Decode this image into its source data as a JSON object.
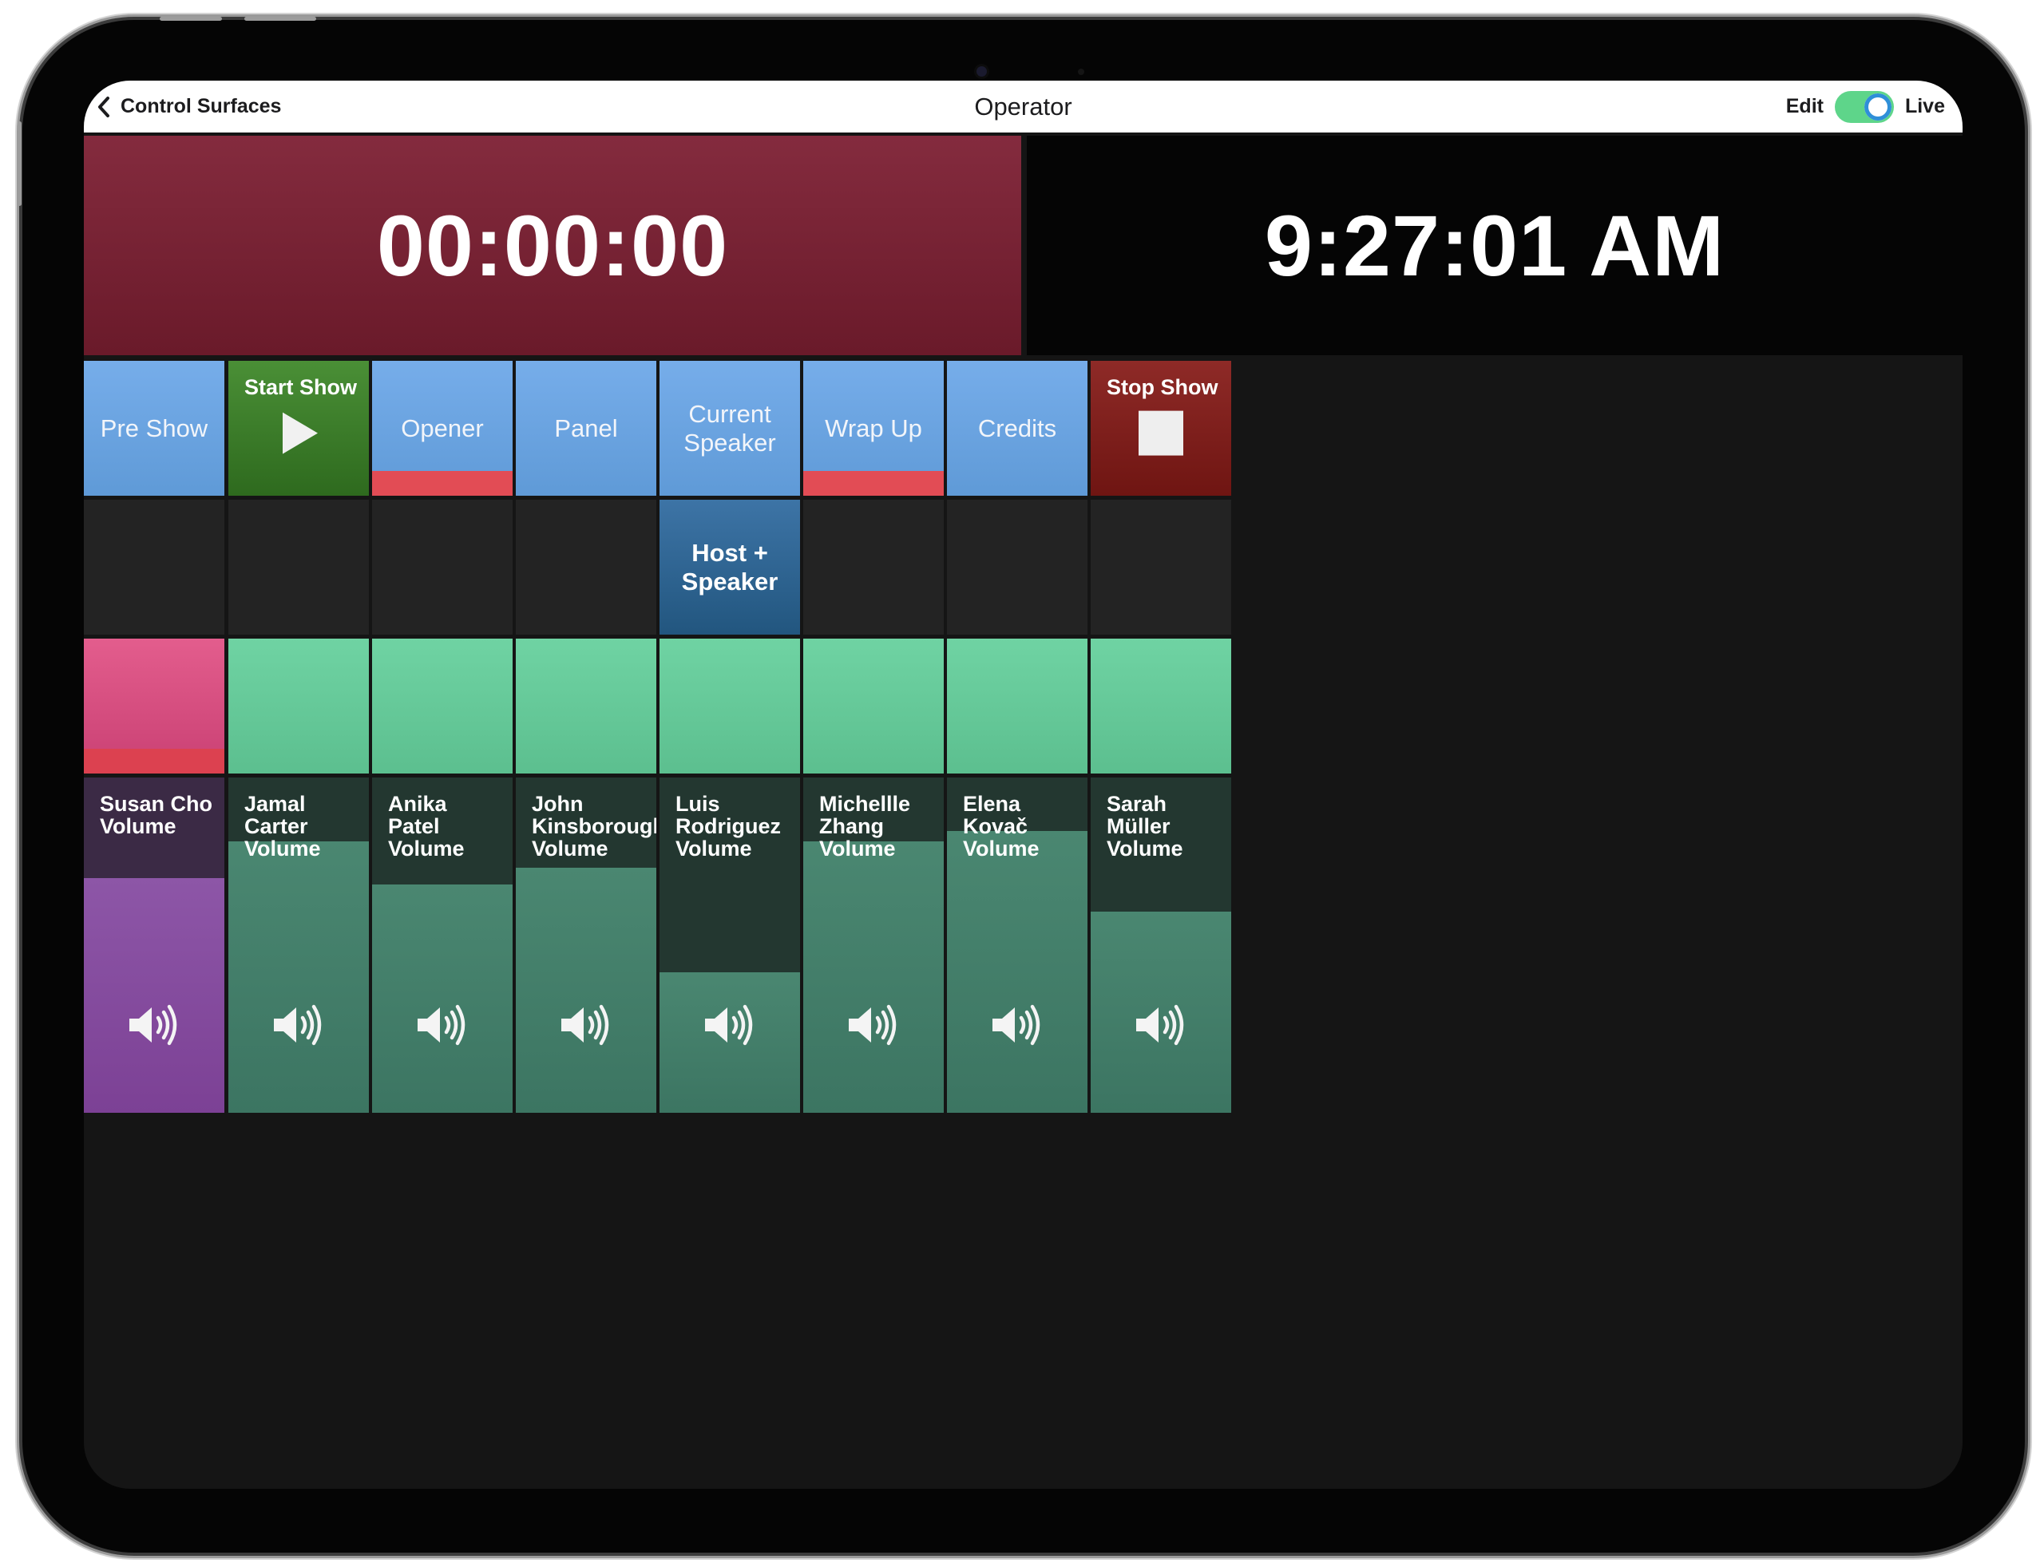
{
  "topbar": {
    "back_label": "Control Surfaces",
    "title": "Operator",
    "mode_left": "Edit",
    "mode_right": "Live",
    "live_enabled": true
  },
  "timers": {
    "countdown": "00:00:00",
    "clock": "9:27:01 AM"
  },
  "colors": {
    "cue_blue": "#6ea6e4",
    "start_green": "#3f8230",
    "stop_red": "#84201d",
    "active_red_bar": "#e24c55",
    "mint": "#66c99a",
    "pink": "#d74f80",
    "purple_fill": "#8550a0",
    "green_fill": "#447f6a",
    "toggle_green": "#5ed58a"
  },
  "row1": [
    {
      "label": "Pre Show",
      "style": "blue",
      "active": false
    },
    {
      "label": "Start Show",
      "style": "green",
      "icon": "play-icon"
    },
    {
      "label": "Opener",
      "style": "blue",
      "active": true
    },
    {
      "label": "Panel",
      "style": "blue",
      "active": false
    },
    {
      "label": "Current Speaker",
      "style": "blue",
      "active": false
    },
    {
      "label": "Wrap Up",
      "style": "blue",
      "active": true
    },
    {
      "label": "Credits",
      "style": "blue",
      "active": false
    },
    {
      "label": "Stop Show",
      "style": "red",
      "icon": "stop-icon"
    }
  ],
  "row2": [
    {
      "label": "",
      "style": "empty"
    },
    {
      "label": "",
      "style": "empty"
    },
    {
      "label": "",
      "style": "empty"
    },
    {
      "label": "",
      "style": "empty"
    },
    {
      "label": "Host + Speaker",
      "style": "navy"
    },
    {
      "label": "",
      "style": "empty"
    },
    {
      "label": "",
      "style": "empty"
    },
    {
      "label": "",
      "style": "empty"
    }
  ],
  "row3": [
    {
      "style": "pink",
      "active": true
    },
    {
      "style": "mint",
      "active": false
    },
    {
      "style": "mint",
      "active": false
    },
    {
      "style": "mint",
      "active": false
    },
    {
      "style": "mint",
      "active": false
    },
    {
      "style": "mint",
      "active": false
    },
    {
      "style": "mint",
      "active": false
    },
    {
      "style": "mint",
      "active": false
    }
  ],
  "volumes": [
    {
      "label": "Susan Cho Volume",
      "level": 0.7,
      "color": "purple",
      "icon": "speaker-icon"
    },
    {
      "label": "Jamal Carter Volume",
      "level": 0.81,
      "color": "green",
      "icon": "speaker-icon"
    },
    {
      "label": "Anika Patel Volume",
      "level": 0.68,
      "color": "green",
      "icon": "speaker-icon"
    },
    {
      "label": "John Kinsborough Volume",
      "level": 0.73,
      "color": "green",
      "icon": "speaker-icon"
    },
    {
      "label": "Luis Rodriguez Volume",
      "level": 0.42,
      "color": "green",
      "icon": "speaker-icon"
    },
    {
      "label": "Michellle Zhang Volume",
      "level": 0.81,
      "color": "green",
      "icon": "speaker-icon"
    },
    {
      "label": "Elena Kovač Volume",
      "level": 0.84,
      "color": "green",
      "icon": "speaker-icon"
    },
    {
      "label": "Sarah Müller Volume",
      "level": 0.6,
      "color": "green",
      "icon": "speaker-icon"
    }
  ]
}
